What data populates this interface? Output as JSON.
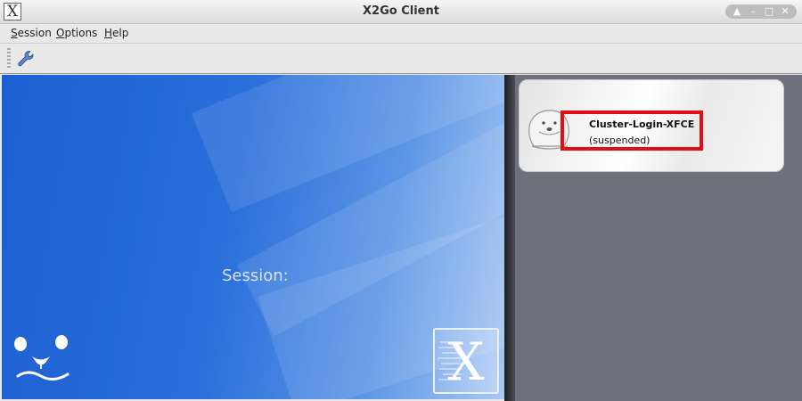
{
  "window": {
    "title": "X2Go Client",
    "app_icon_glyph": "X",
    "controls": [
      {
        "name": "maximize-up-button",
        "glyph": "▲"
      },
      {
        "name": "minimize-button",
        "glyph": "–"
      },
      {
        "name": "maximize-button",
        "glyph": "□"
      },
      {
        "name": "close-button",
        "glyph": "✕"
      }
    ]
  },
  "menubar": {
    "items": [
      {
        "name": "menu-session",
        "mnemonic": "S",
        "rest": "ession"
      },
      {
        "name": "menu-options",
        "mnemonic": "O",
        "rest": "ptions"
      },
      {
        "name": "menu-help",
        "mnemonic": "H",
        "rest": "elp"
      }
    ]
  },
  "toolbar": {
    "icon": "wrench-icon"
  },
  "main": {
    "session_label": "Session:",
    "logo_letter": "X",
    "background_color": "#1c5fd2"
  },
  "sessions": [
    {
      "name": "Cluster-Login-XFCE",
      "status": "(suspended)",
      "highlight_color": "#e40d12"
    }
  ]
}
